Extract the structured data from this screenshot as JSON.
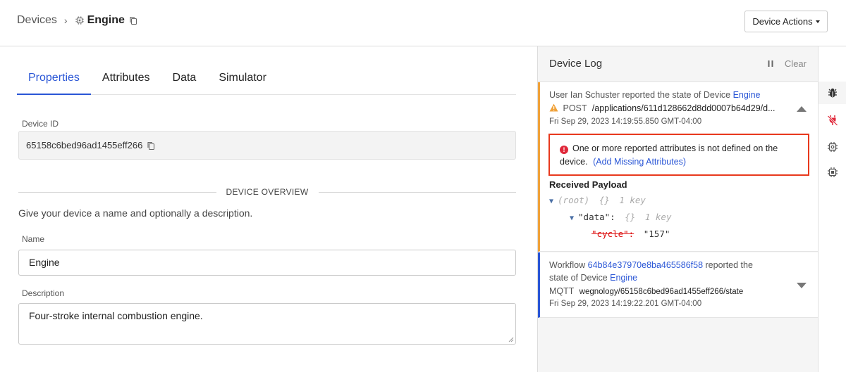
{
  "breadcrumb": {
    "root": "Devices",
    "separator": "›",
    "current": "Engine"
  },
  "header": {
    "actions_label": "Device Actions"
  },
  "tabs": [
    {
      "label": "Properties",
      "active": true
    },
    {
      "label": "Attributes",
      "active": false
    },
    {
      "label": "Data",
      "active": false
    },
    {
      "label": "Simulator",
      "active": false
    }
  ],
  "properties": {
    "device_id_label": "Device ID",
    "device_id": "65158c6bed96ad1455eff266",
    "overview_heading": "DEVICE OVERVIEW",
    "overview_help": "Give your device a name and optionally a description.",
    "name_label": "Name",
    "name_value": "Engine",
    "description_label": "Description",
    "description_value": "Four-stroke internal combustion engine."
  },
  "log": {
    "title": "Device Log",
    "clear_label": "Clear",
    "entries": [
      {
        "prefix": "User Ian Schuster reported the state of Device",
        "device_link": "Engine",
        "method": "POST",
        "path": "/applications/611d128662d8dd0007b64d29/d...",
        "timestamp": "Fri Sep 29, 2023 14:19:55.850 GMT-04:00",
        "error_text": "One or more reported attributes is not defined on the device.",
        "error_link": "(Add Missing Attributes)",
        "payload_title": "Received Payload",
        "payload_root": "(root)",
        "payload_root_braces": "{}",
        "payload_root_count": "1 key",
        "payload_data_key": "\"data\":",
        "payload_data_braces": "{}",
        "payload_data_count": "1 key",
        "payload_cycle_key": "\"cycle\":",
        "payload_cycle_value": "\"157\""
      },
      {
        "prefix": "Workflow",
        "workflow_link": "64b84e37970e8ba465586f58",
        "suffix": "reported the",
        "line2_prefix": "state of Device",
        "device_link": "Engine",
        "method": "MQTT",
        "topic": "wegnology/65158c6bed96ad1455eff266/state",
        "timestamp": "Fri Sep 29, 2023 14:19:22.201 GMT-04:00"
      }
    ]
  },
  "colors": {
    "accent": "#2a56d6",
    "warning": "#f0a23a",
    "error": "#e8391d"
  }
}
